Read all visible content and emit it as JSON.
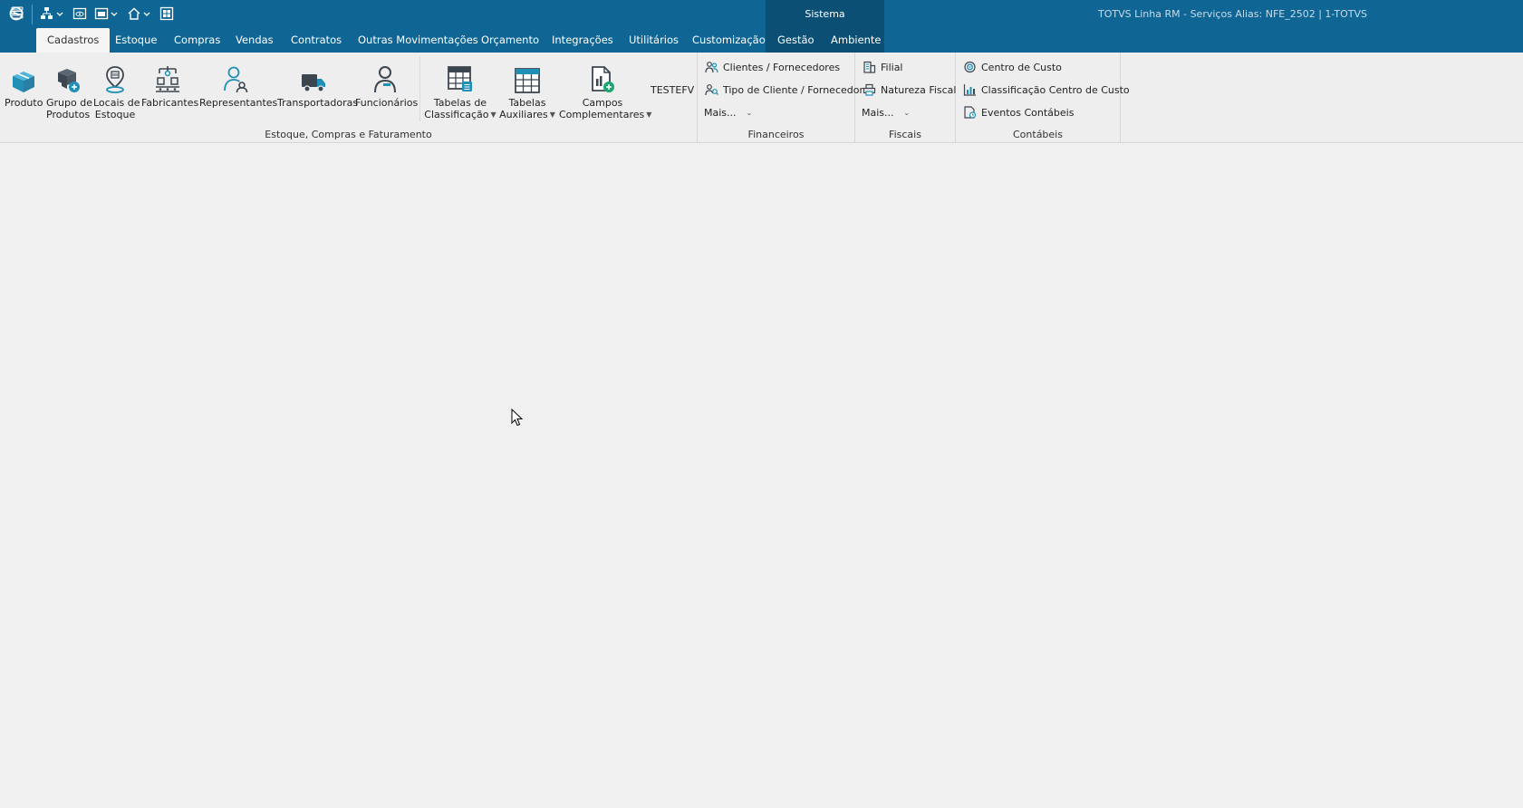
{
  "titlebar": {
    "center_label": "Sistema",
    "info": "TOTVS Linha RM - Serviços  Alias: NFE_2502 | 1-TOTVS",
    "quick_access": [
      {
        "icon": "totvs-logo-icon"
      },
      {
        "icon": "org-chart-icon",
        "has_dropdown": true
      },
      {
        "icon": "view-icon"
      },
      {
        "icon": "window-icon",
        "has_dropdown": true
      },
      {
        "icon": "home-icon",
        "has_dropdown": true
      },
      {
        "icon": "grid-icon"
      }
    ]
  },
  "tabs": [
    {
      "label": "Cadastros",
      "active": true
    },
    {
      "label": "Estoque"
    },
    {
      "label": "Compras"
    },
    {
      "label": "Vendas"
    },
    {
      "label": "Contratos"
    },
    {
      "label": "Outras Movimentações"
    },
    {
      "label": "Orçamento"
    },
    {
      "label": "Integrações"
    },
    {
      "label": "Utilitários"
    },
    {
      "label": "Customização"
    },
    {
      "label": "Gestão"
    },
    {
      "label": "Ambiente"
    }
  ],
  "ribbon": {
    "estoque_group": {
      "label": "Estoque, Compras e Faturamento",
      "buttons": {
        "produto": {
          "line1": "Produto",
          "line2": "",
          "icon": "box-icon"
        },
        "grupo_produtos": {
          "line1": "Grupo de",
          "line2": "Produtos",
          "icon": "boxes-group-icon"
        },
        "locais_estoque": {
          "line1": "Locais de",
          "line2": "Estoque",
          "icon": "location-pin-icon"
        },
        "fabricantes": {
          "line1": "Fabricantes",
          "line2": "",
          "icon": "factory-icon"
        },
        "representantes": {
          "line1": "Representantes",
          "line2": "",
          "icon": "person-user-icon"
        },
        "transportadoras": {
          "line1": "Transportadoras",
          "line2": "",
          "icon": "truck-icon"
        },
        "funcionarios": {
          "line1": "Funcionários",
          "line2": "",
          "icon": "employee-icon"
        },
        "tabelas_classificacao": {
          "line1": "Tabelas de",
          "line2": "Classificação",
          "icon": "table-list-icon",
          "has_dropdown": true
        },
        "tabelas_auxiliares": {
          "line1": "Tabelas",
          "line2": "Auxiliares",
          "icon": "table-icon",
          "has_dropdown": true
        },
        "campos_complementares": {
          "line1": "Campos",
          "line2": "Complementares",
          "icon": "document-add-icon",
          "has_dropdown": true
        },
        "testefv": {
          "label": "TESTEFV"
        }
      }
    },
    "financeiros_group": {
      "label": "Financeiros",
      "items": [
        {
          "label": "Clientes / Fornecedores",
          "icon": "people-icon"
        },
        {
          "label": "Tipo de Cliente / Fornecedor",
          "icon": "people-search-icon"
        }
      ],
      "more": "Mais..."
    },
    "fiscais_group": {
      "label": "Fiscais",
      "items": [
        {
          "label": "Filial",
          "icon": "building-icon"
        },
        {
          "label": "Natureza Fiscal",
          "icon": "printer-icon"
        }
      ],
      "more": "Mais..."
    },
    "contabeis_group": {
      "label": "Contábeis",
      "items": [
        {
          "label": "Centro de Custo",
          "icon": "target-icon"
        },
        {
          "label": "Classificação Centro de Custo",
          "icon": "bar-chart-icon"
        },
        {
          "label": "Eventos Contábeis",
          "icon": "document-event-icon"
        }
      ]
    }
  },
  "colors": {
    "titlebar": "#0f6594",
    "sistema_tab": "#0c4f74",
    "ribbon_bg": "#eeeeee",
    "workspace_bg": "#f0f0f0",
    "icon_teal": "#1f8fb5",
    "icon_dark": "#3c4650"
  }
}
